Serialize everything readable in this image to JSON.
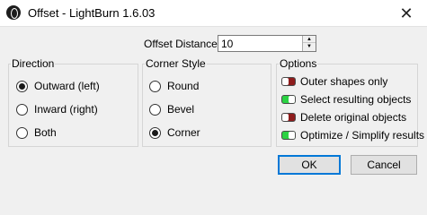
{
  "window": {
    "title": "Offset - LightBurn 1.6.03",
    "close_glyph": "✕"
  },
  "offset_distance": {
    "label": "Offset Distance",
    "value": "10",
    "up_glyph": "▲",
    "down_glyph": "▼"
  },
  "direction": {
    "title": "Direction",
    "options": [
      {
        "label": "Outward (left)",
        "checked": true
      },
      {
        "label": "Inward (right)",
        "checked": false
      },
      {
        "label": "Both",
        "checked": false
      }
    ]
  },
  "corner_style": {
    "title": "Corner Style",
    "options": [
      {
        "label": "Round",
        "checked": false
      },
      {
        "label": "Bevel",
        "checked": false
      },
      {
        "label": "Corner",
        "checked": true
      }
    ]
  },
  "options": {
    "title": "Options",
    "items": [
      {
        "label": "Outer shapes only",
        "enabled": false
      },
      {
        "label": "Select resulting objects",
        "enabled": true
      },
      {
        "label": "Delete original objects",
        "enabled": false
      },
      {
        "label": "Optimize / Simplify results",
        "enabled": true
      }
    ]
  },
  "buttons": {
    "ok": "OK",
    "cancel": "Cancel"
  },
  "colors": {
    "toggle_on": "#2bd243",
    "toggle_off": "#8e1c1c",
    "default_button_border": "#0078d7"
  }
}
